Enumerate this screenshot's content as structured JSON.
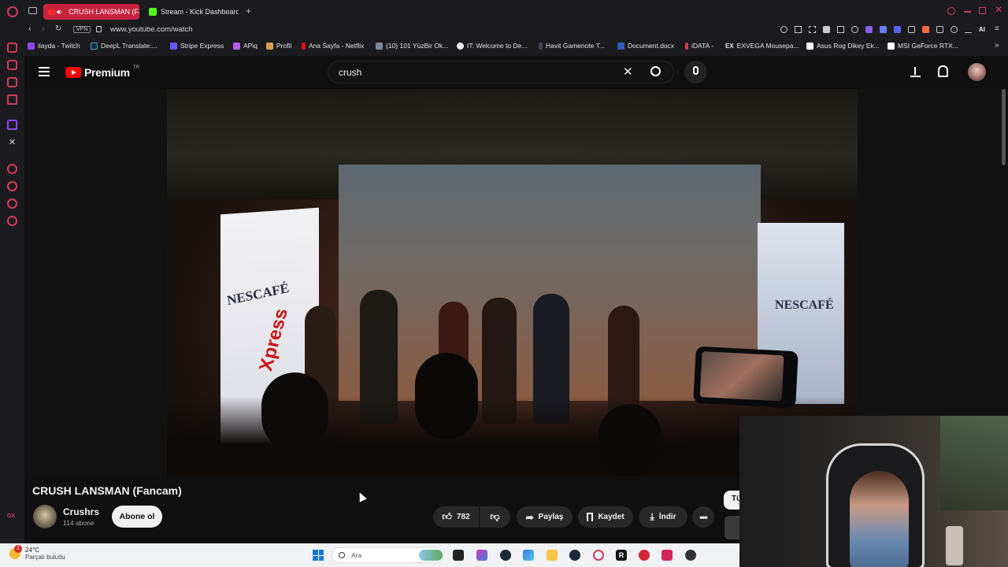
{
  "browser": {
    "tabs": [
      {
        "label": "CRUSH LANSMAN (Fan",
        "active": true
      },
      {
        "label": "Stream - Kick Dashboard",
        "active": false
      }
    ],
    "address": {
      "vpn_label": "VPN",
      "url": "www.youtube.com/watch"
    },
    "toolbar_ai_label": "AI",
    "bookmarks": [
      "ilayda - Twitch",
      "DeepL Translate:...",
      "Stripe Express",
      "APiq",
      "Profil",
      "Ana Sayfa - Netflix",
      "(10) 101 YüzBir Ok...",
      "IT: Welcome to De...",
      "Havit Gamenote T...",
      "Document.docx",
      "iDATA -",
      "EXVEGA Mousepa...",
      "Asus Rog Dikey Ek...",
      "MSI GeForce RTX..."
    ]
  },
  "youtube": {
    "logo_text": "Premium",
    "region": "TR",
    "search": {
      "value": "crush"
    },
    "video": {
      "title": "CRUSH LANSMAN (Fancam)",
      "banner_text_left": "NESCAFÉ",
      "banner_text_right": "NESCAFÉ",
      "xpress_text": "Xpress"
    },
    "channel": {
      "name": "Crushrs",
      "subscribers": "114 abone",
      "subscribe_label": "Abone ol"
    },
    "actions": {
      "likes": "782",
      "share": "Paylaş",
      "save": "Kaydet",
      "download": "İndir"
    },
    "chip_partial": "Tü"
  },
  "taskbar": {
    "weather_temp": "24°C",
    "weather_desc": "Parçalı bulutlu",
    "notification_count": "1",
    "search_label": "Ara"
  },
  "colors": {
    "accent": "#c8223f",
    "yt_red": "#ff0000",
    "bg": "#0f0f0f"
  }
}
